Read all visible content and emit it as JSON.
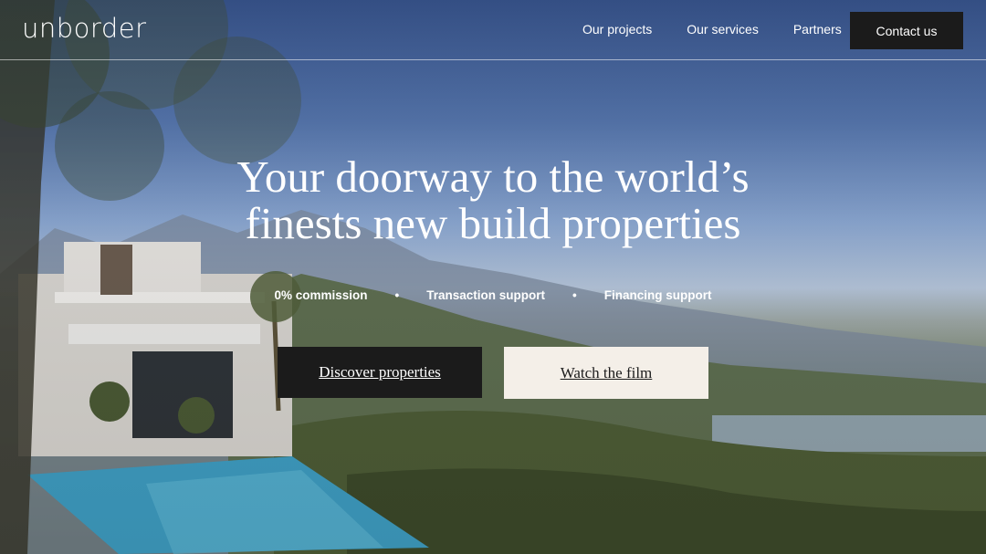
{
  "brand": {
    "logo_text": "unborder"
  },
  "nav": {
    "items": [
      {
        "label": "Our projects"
      },
      {
        "label": "Our services"
      },
      {
        "label": "Partners"
      }
    ],
    "contact_label": "Contact us"
  },
  "hero": {
    "headline_line1": "Your doorway to the world’s",
    "headline_line2": "finests new build properties",
    "features": [
      "0% commission",
      "Transaction support",
      "Financing support"
    ],
    "separator": "•",
    "primary_cta": "Discover properties",
    "secondary_cta": "Watch the film"
  },
  "colors": {
    "button_dark": "#1b1b1b",
    "button_light": "#f4efe8"
  }
}
